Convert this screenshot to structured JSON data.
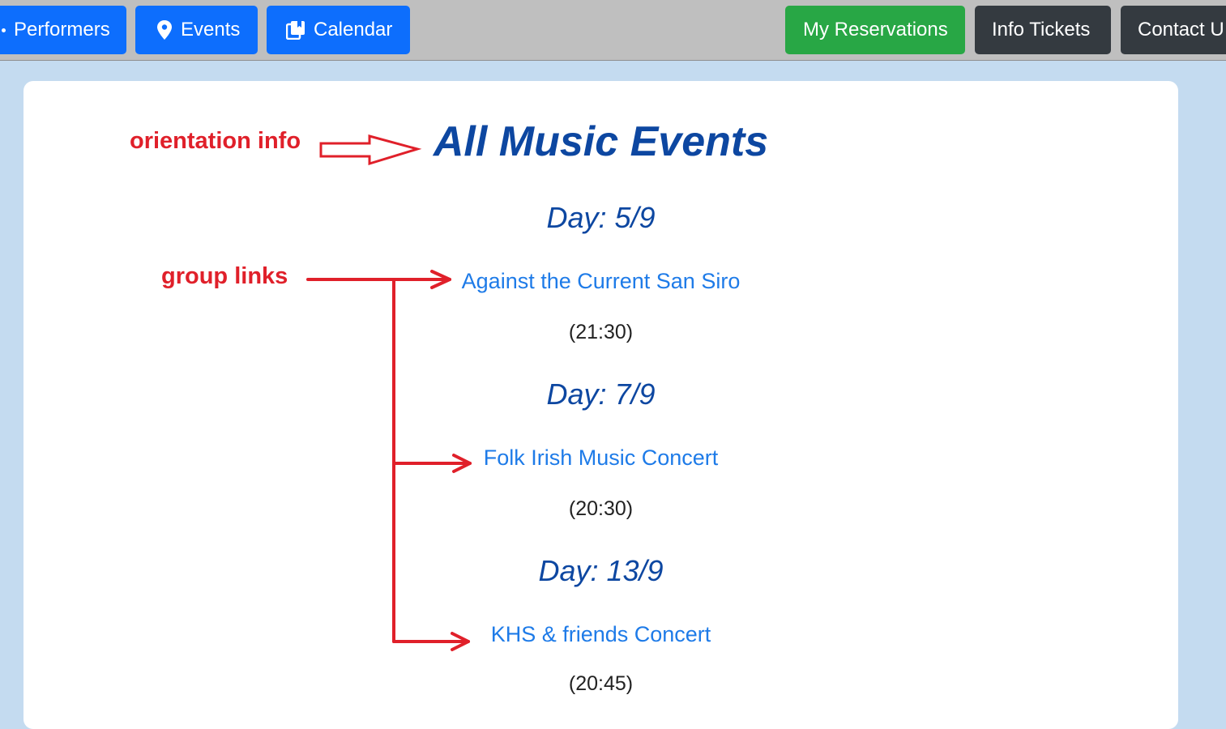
{
  "nav": {
    "performers_label": "Performers",
    "events_label": "Events",
    "calendar_label": "Calendar",
    "reservations_label": "My Reservations",
    "info_tickets_label": "Info Tickets",
    "contact_label": "Contact U"
  },
  "page": {
    "title": "All Music Events"
  },
  "days": [
    {
      "heading": "Day: 5/9",
      "event": {
        "name": "Against the Current San Siro",
        "time": "(21:30)"
      }
    },
    {
      "heading": "Day: 7/9",
      "event": {
        "name": "Folk Irish Music Concert",
        "time": "(20:30)"
      }
    },
    {
      "heading": "Day: 13/9",
      "event": {
        "name": "KHS & friends Concert",
        "time": "(20:45)"
      }
    }
  ],
  "annotations": {
    "orientation_label": "orientation info",
    "group_links_label": "group links"
  },
  "icons": {
    "events": "map-pin-icon",
    "calendar": "calendar-icon"
  },
  "colors": {
    "nav_primary": "#0d6efd",
    "nav_success": "#28a745",
    "nav_dark": "#343a40",
    "heading": "#0d47a1",
    "link": "#1e7be8",
    "annotation": "#e0202a",
    "page_background": "#c4dbf0"
  }
}
